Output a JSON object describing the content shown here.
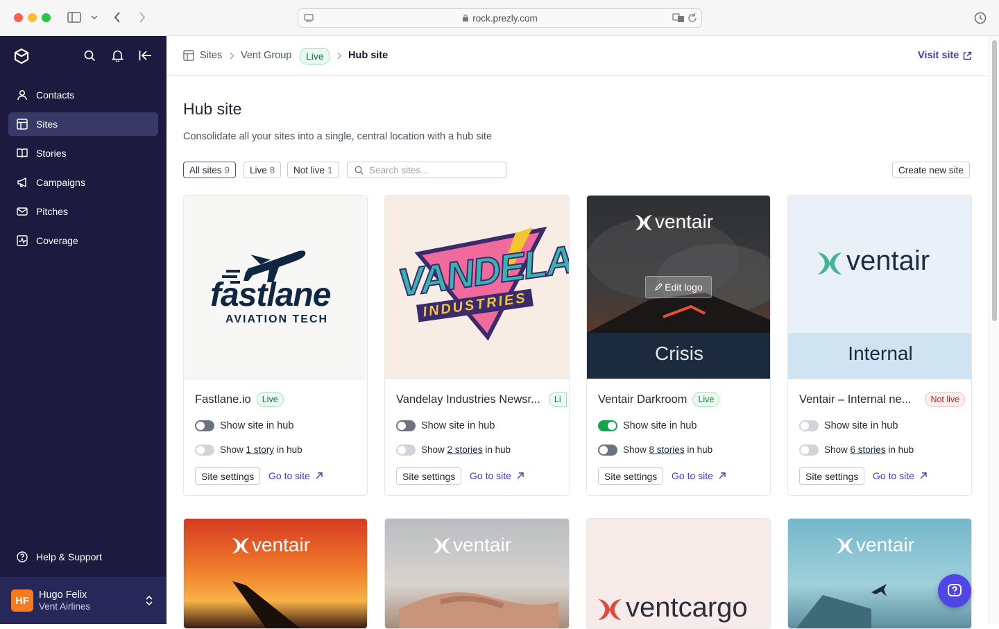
{
  "browser": {
    "url": "rock.prezly.com"
  },
  "sidebar": {
    "items": [
      {
        "label": "Contacts",
        "icon": "user-icon"
      },
      {
        "label": "Sites",
        "icon": "layout-icon"
      },
      {
        "label": "Stories",
        "icon": "book-icon"
      },
      {
        "label": "Campaigns",
        "icon": "megaphone-icon"
      },
      {
        "label": "Pitches",
        "icon": "mail-icon"
      },
      {
        "label": "Coverage",
        "icon": "chart-icon"
      }
    ],
    "help": "Help & Support",
    "user": {
      "initials": "HF",
      "name": "Hugo Felix",
      "org": "Vent Airlines"
    }
  },
  "breadcrumb": {
    "sites": "Sites",
    "group": "Vent Group",
    "group_status": "Live",
    "current": "Hub site"
  },
  "header": {
    "visit": "Visit site"
  },
  "page": {
    "title": "Hub site",
    "subtitle": "Consolidate all your sites into a single, central location with a hub site"
  },
  "filters": {
    "all": "All sites",
    "all_count": "9",
    "live": "Live",
    "live_count": "8",
    "notlive": "Not live",
    "notlive_count": "1",
    "search_placeholder": "Search sites...",
    "create": "Create new site"
  },
  "cards": [
    {
      "name": "Fastlane.io",
      "status": "Live",
      "hub_label": "Show site in hub",
      "stories_pre": "Show",
      "stories_link": "1 story",
      "stories_post": "in hub",
      "settings": "Site settings",
      "goto": "Go to site",
      "logo_main": "fastlane",
      "logo_sub": "AVIATION TECH"
    },
    {
      "name": "Vandelay Industries Newsr...",
      "status": "Li",
      "hub_label": "Show site in hub",
      "stories_pre": "Show",
      "stories_link": "2 stories",
      "stories_post": "in hub",
      "settings": "Site settings",
      "goto": "Go to site",
      "logo_main": "VANDELAY",
      "logo_sub": "INDUSTRIES"
    },
    {
      "name": "Ventair Darkroom",
      "status": "Live",
      "hub_label": "Show site in hub",
      "stories_pre": "Show",
      "stories_link": "8 stories",
      "stories_post": "in hub",
      "settings": "Site settings",
      "goto": "Go to site",
      "logo_main": "ventair",
      "logo_sub": "Crisis",
      "edit": "Edit logo"
    },
    {
      "name": "Ventair – Internal ne...",
      "status": "Not live",
      "hub_label": "Show site in hub",
      "stories_pre": "Show",
      "stories_link": "6 stories",
      "stories_post": "in hub",
      "settings": "Site settings",
      "goto": "Go to site",
      "logo_main": "ventair",
      "logo_sub": "Internal"
    }
  ],
  "cards2": [
    {
      "logo": "ventair"
    },
    {
      "logo": "ventair"
    },
    {
      "logo": "ventcargo"
    },
    {
      "logo": "ventair"
    }
  ],
  "colors": {
    "sidebar": "#1c1b3f",
    "accent": "#4338ca",
    "live": "#0f7a3f",
    "toggle_on": "#16a34a"
  }
}
